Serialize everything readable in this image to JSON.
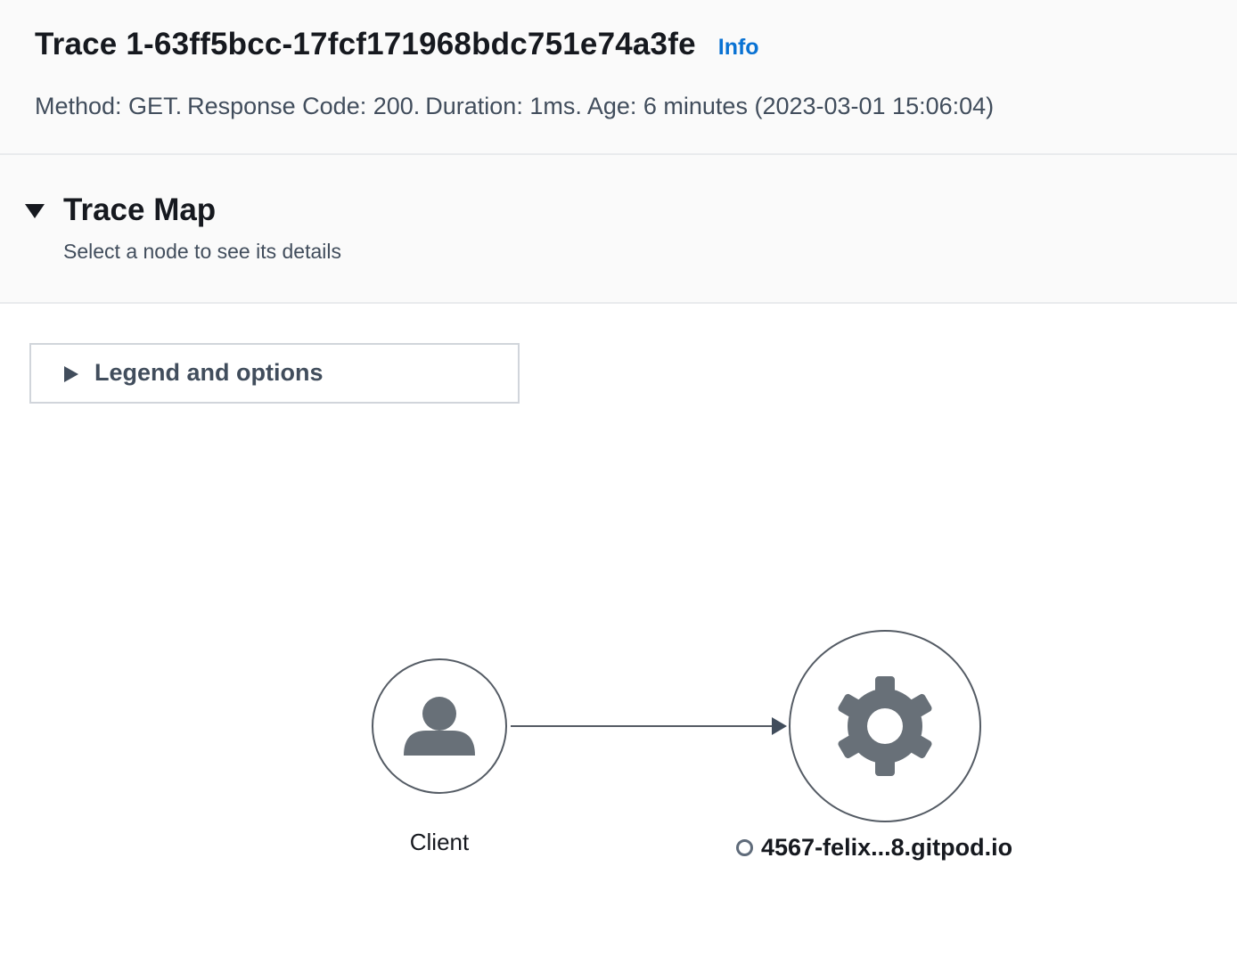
{
  "header": {
    "title": "Trace 1-63ff5bcc-17fcf171968bdc751e74a3fe",
    "info_label": "Info",
    "meta": {
      "method": "Method: GET.",
      "response_code": "Response Code: 200.",
      "duration": "Duration: 1ms.",
      "age": "Age: 6 minutes (2023-03-01 15:06:04)"
    }
  },
  "trace_map": {
    "title": "Trace Map",
    "description": "Select a node to see its details",
    "expanded": true
  },
  "legend": {
    "label": "Legend and options",
    "expanded": false
  },
  "nodes": {
    "client": {
      "label": "Client",
      "icon": "user-icon"
    },
    "service": {
      "label": "4567-felix...8.gitpod.io",
      "icon": "gear-icon",
      "status_icon": "status-ok-ring-icon"
    }
  },
  "colors": {
    "accent_link": "#0972d3",
    "icon_fill": "#687078",
    "node_stroke": "#545b64",
    "header_bg": "#fafafa"
  }
}
